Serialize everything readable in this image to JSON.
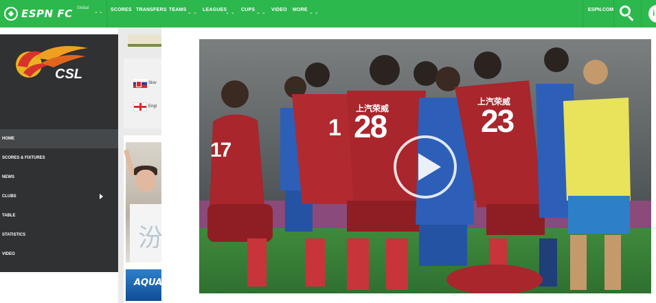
{
  "header": {
    "brand": "ESPN FC",
    "edition": "Global",
    "nav": [
      {
        "label": "SCORES"
      },
      {
        "label": "TRANSFERS"
      },
      {
        "label": "TEAMS"
      },
      {
        "label": "LEAGUES"
      },
      {
        "label": "CUPS"
      },
      {
        "label": "VIDEO"
      },
      {
        "label": "MORE"
      }
    ],
    "espn_link": "ESPN.COM",
    "search_icon": "search-icon",
    "profile_initial": "i"
  },
  "sidebar": {
    "logo_text": "CSL",
    "items": [
      {
        "label": "HOME",
        "active": true
      },
      {
        "label": "SCORES & FIXTURES"
      },
      {
        "label": "NEWS"
      },
      {
        "label": "CLUBS",
        "has_submenu": true
      },
      {
        "label": "TABLE"
      },
      {
        "label": "STATISTICS"
      },
      {
        "label": "VIDEO"
      }
    ]
  },
  "languages": [
    {
      "label": "Slov",
      "flag": "slovakia-flag"
    },
    {
      "label": "Engl",
      "flag": "england-flag"
    }
  ],
  "ad": {
    "character": "汾",
    "brand": "AQUA"
  },
  "video": {
    "jersey_numbers": [
      "28",
      "23",
      "17",
      "1"
    ],
    "jersey_text": [
      "上汽荣威",
      "上汽荣威"
    ],
    "play_icon": "play-icon"
  },
  "colors": {
    "brand_green": "#2db84d",
    "sidebar_dark": "#2f3133",
    "kit_red": "#a8262c",
    "kit_blue": "#2d5fb8"
  }
}
